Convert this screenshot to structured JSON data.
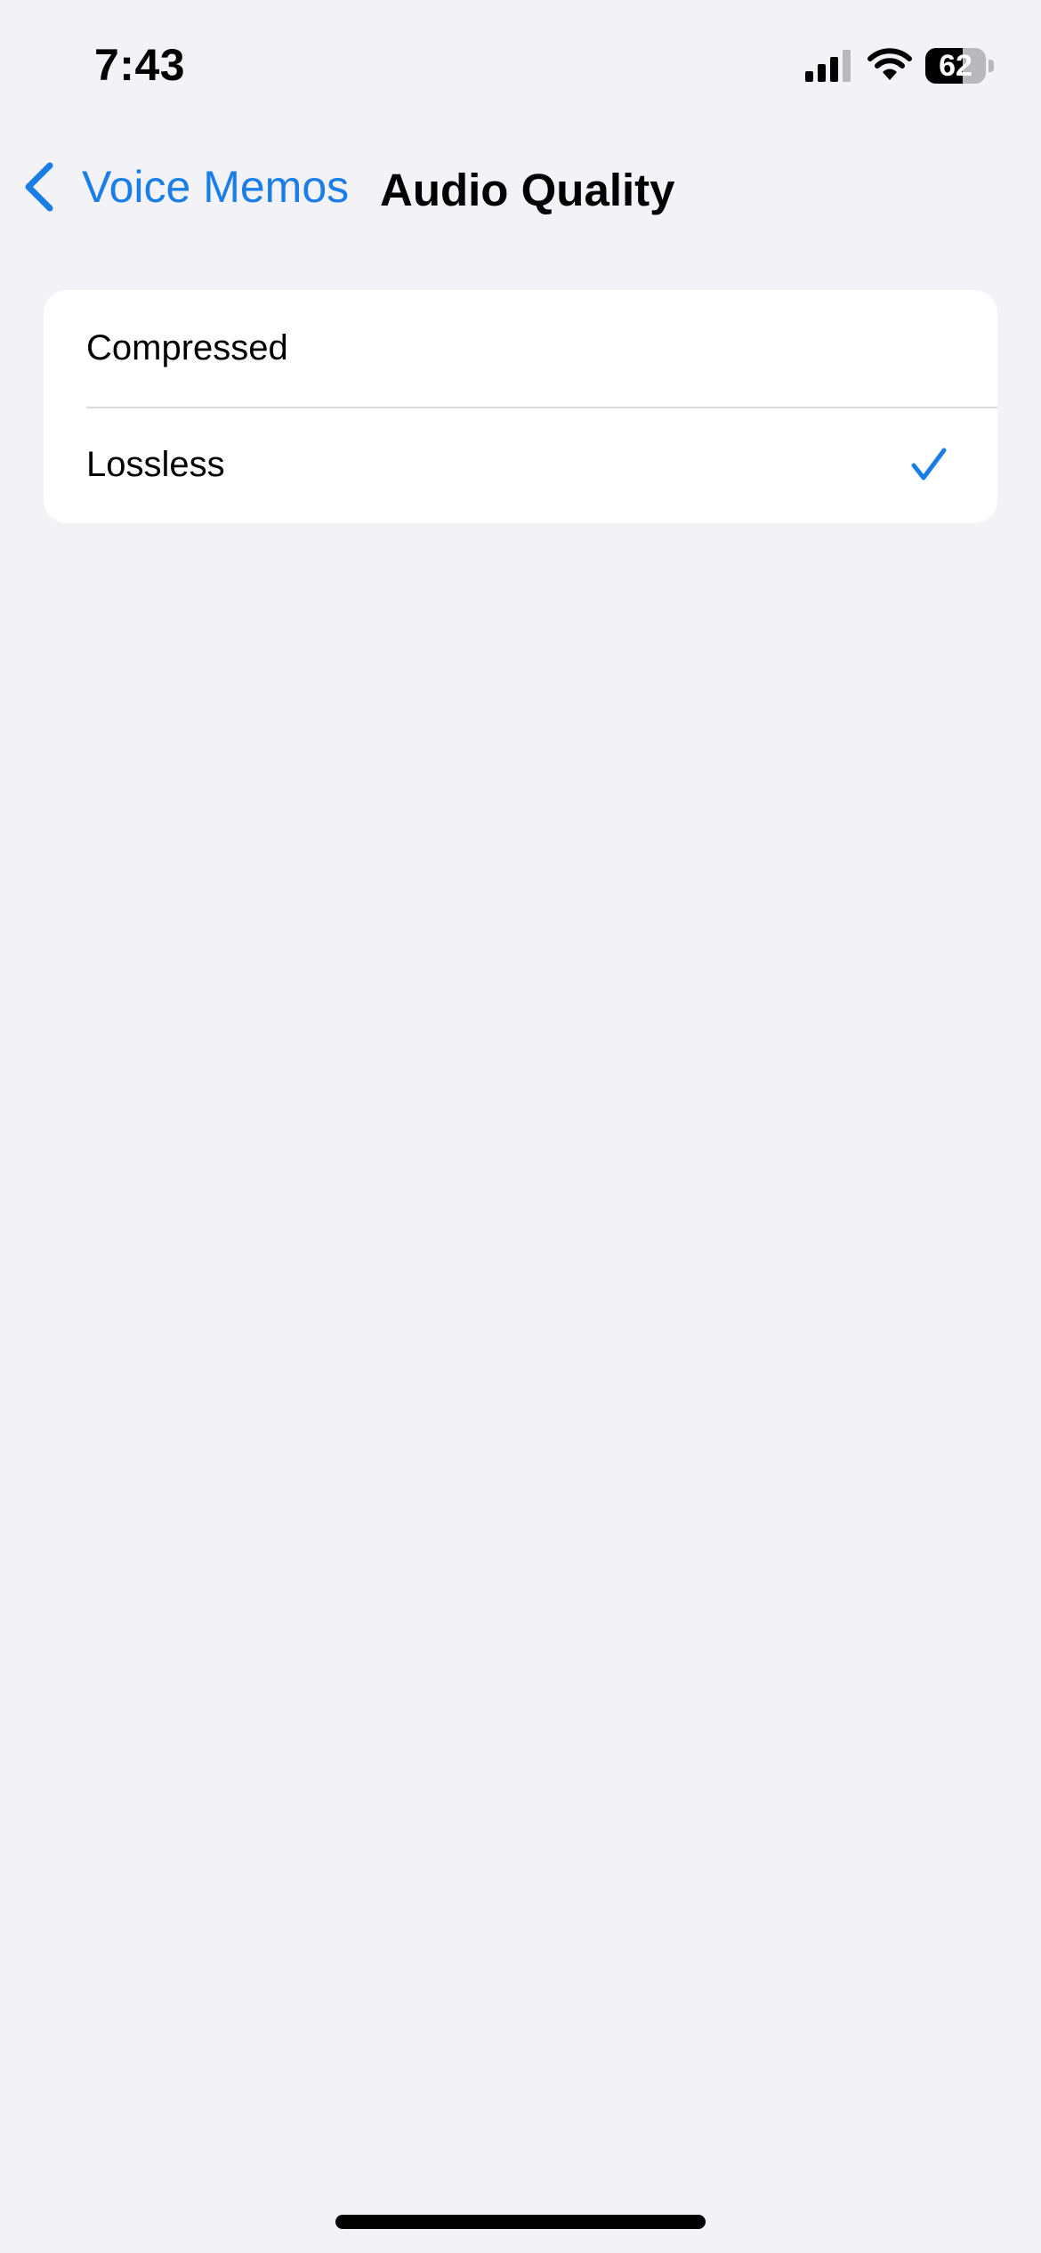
{
  "status_bar": {
    "time": "7:43",
    "battery_percent": "62",
    "battery_level": 0.62,
    "icons": [
      "signal-icon",
      "wifi-icon",
      "battery-icon"
    ]
  },
  "nav": {
    "back_label": "Voice Memos",
    "back_icon": "chevron-left-icon",
    "title": "Audio Quality"
  },
  "options": [
    {
      "label": "Compressed",
      "selected": false
    },
    {
      "label": "Lossless",
      "selected": true
    }
  ],
  "colors": {
    "accent": "#1a7ee6",
    "background": "#f2f2f7",
    "card": "#ffffff",
    "separator": "#d9d9de"
  }
}
